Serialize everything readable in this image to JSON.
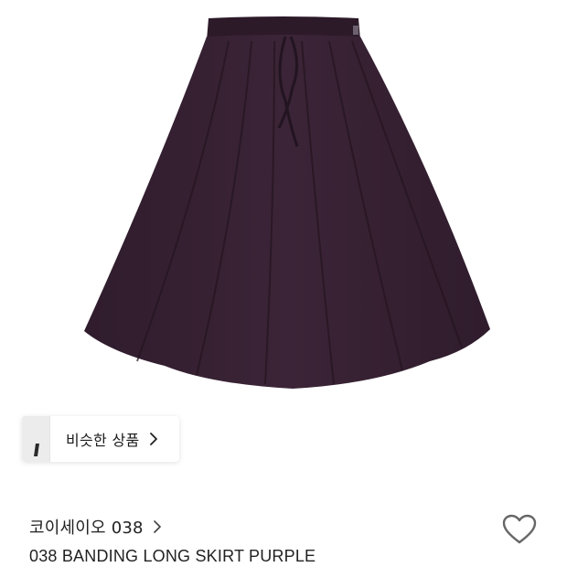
{
  "product": {
    "image": "purple-long-skirt-photo",
    "brand": "코이세이오 038",
    "name": "038 BANDING LONG SKIRT PURPLE"
  },
  "similar": {
    "label": "비슷한 상품"
  },
  "icons": {
    "wishlist": "heart-outline-icon",
    "chevron": "chevron-right-icon"
  },
  "colors": {
    "skirt": "#3a2336",
    "text": "#222222"
  }
}
